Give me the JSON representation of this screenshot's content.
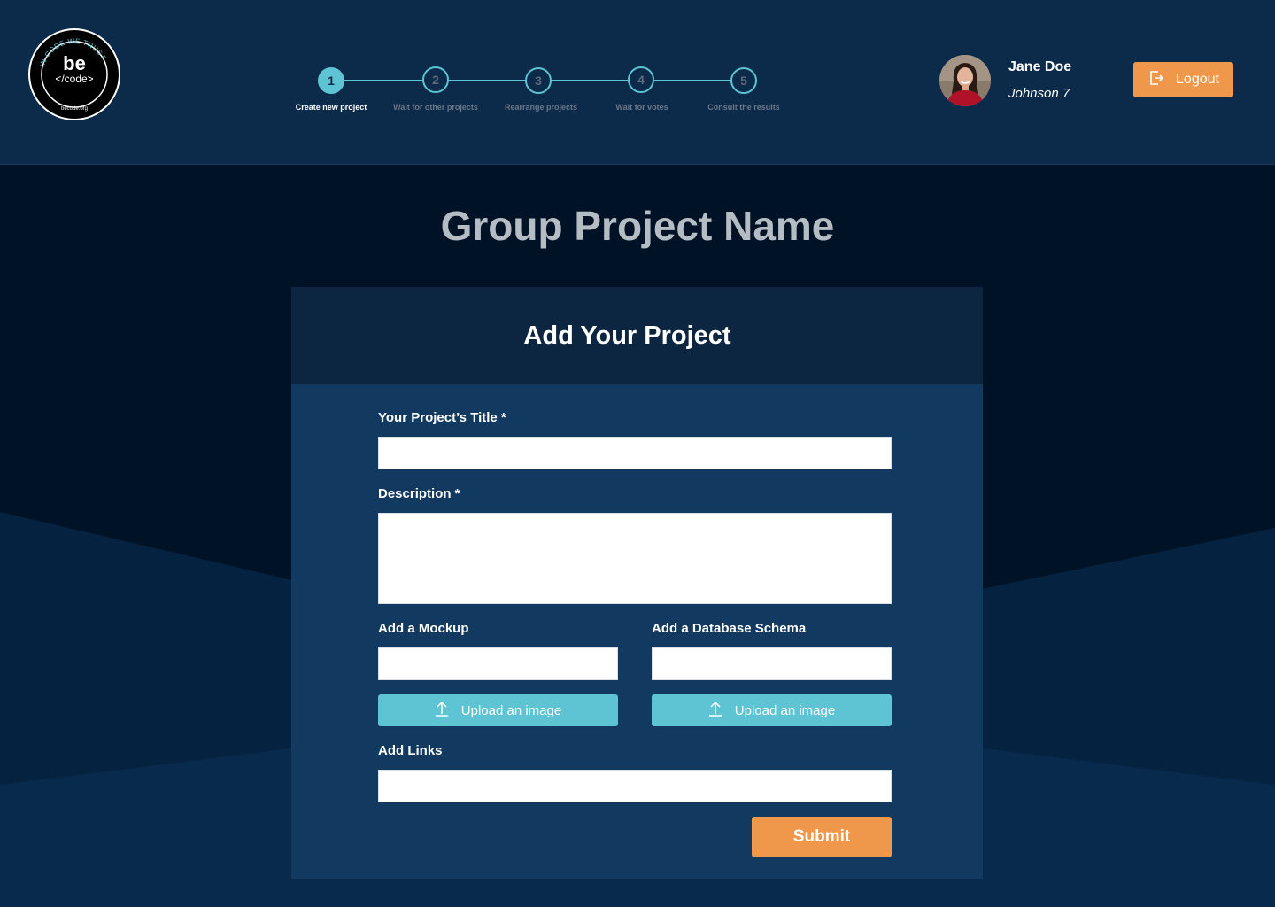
{
  "brand": {
    "logo_ring_text": "IN CODE WE TRUST",
    "logo_main": "be",
    "logo_sub": "</code>",
    "logo_url": "becode.org"
  },
  "stepper": {
    "steps": [
      {
        "number": "1",
        "label": "Create new project",
        "active": true
      },
      {
        "number": "2",
        "label": "Wait for other projects",
        "active": false
      },
      {
        "number": "3",
        "label": "Rearrange projects",
        "active": false
      },
      {
        "number": "4",
        "label": "Wait for votes",
        "active": false
      },
      {
        "number": "5",
        "label": "Consult the results",
        "active": false
      }
    ]
  },
  "user": {
    "name": "Jane Doe",
    "group": "Johnson 7",
    "logout_label": "Logout",
    "logout_icon": "logout-icon"
  },
  "page": {
    "title": "Group Project Name"
  },
  "form": {
    "heading": "Add Your Project",
    "title_label": "Your Project’s Title *",
    "title_value": "",
    "description_label": "Description *",
    "description_value": "",
    "mockup_label": "Add a Mockup",
    "mockup_value": "",
    "schema_label": "Add a Database Schema",
    "schema_value": "",
    "upload_label": "Upload an image",
    "upload_icon": "upload-icon",
    "links_label": "Add Links",
    "links_value": "",
    "submit_label": "Submit"
  },
  "colors": {
    "header_bg": "#0c2a4a",
    "accent_teal": "#5ec3d2",
    "accent_orange": "#ef974a",
    "card_bg": "#123a60",
    "card_head_bg": "#0c2541"
  }
}
